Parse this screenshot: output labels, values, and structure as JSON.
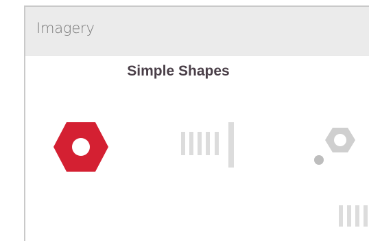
{
  "panel": {
    "title": "Imagery"
  },
  "section": {
    "heading": "Simple Shapes"
  },
  "shapes": [
    {
      "icon": "hexagon-nut-icon",
      "color": "#d42032",
      "state": "selected"
    },
    {
      "icon": "bar-scale-icon",
      "color": "#d8d8d8",
      "state": "faded"
    },
    {
      "icon": "dot-hexagon-icon",
      "color": "#bdbdbd",
      "state": "faded"
    },
    {
      "icon": "bar-scale-icon",
      "color": "#d8d8d8",
      "state": "faded"
    }
  ]
}
